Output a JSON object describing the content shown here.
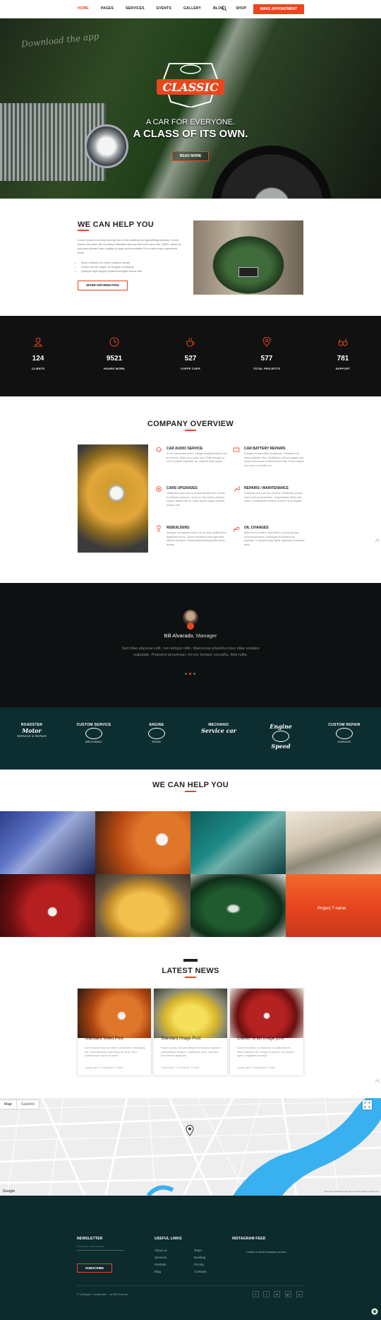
{
  "nav": {
    "items": [
      {
        "label": "HOME",
        "active": true
      },
      {
        "label": "PAGES",
        "active": false
      },
      {
        "label": "SERVICES",
        "active": false
      },
      {
        "label": "EVENTS",
        "active": false
      },
      {
        "label": "GALLERY",
        "active": false
      },
      {
        "label": "BLOG",
        "active": false
      },
      {
        "label": "SHOP",
        "active": false
      }
    ],
    "search_icon": "search-icon",
    "cta": "MAKE APPOINTMENT"
  },
  "hero": {
    "badge": "CLASSIC",
    "tagline1": "A CAR FOR EVERYONE.",
    "tagline2": "A CLASS OF ITS OWN.",
    "button": "READ MORE",
    "script_text": "Download the app"
  },
  "help": {
    "title": "WE CAN HELP YOU",
    "description": "Lorem ipsum is simply dummy text of the printing and typesetting industry. Lorem Ipsum has been the industry's standard dummy text ever since the 1500s, when an unknown printer took a galley of type and scrambled it to make a type specimen book.",
    "bullets": [
      "Nunc euismod eu tortor volutpat ornare",
      "Donec rutrum neque eu feugiat consequat",
      "Quisque eget augue pharetra fringilla cursus sed"
    ],
    "button": "MORE INFORMATION"
  },
  "stats": [
    {
      "icon": "user-icon",
      "value": "124",
      "label": "CLIENTS"
    },
    {
      "icon": "clock-icon",
      "value": "9521",
      "label": "HOURS WORK"
    },
    {
      "icon": "coffee-icon",
      "value": "527",
      "label": "COFFE CUPS"
    },
    {
      "icon": "location-icon",
      "value": "577",
      "label": "TOTAL PROJECTS"
    },
    {
      "icon": "glasses-icon",
      "value": "781",
      "label": "SUPPORT"
    }
  ],
  "overview": {
    "title": "COMPANY OVERVIEW",
    "services": [
      {
        "icon": "bell-icon",
        "title": "CAR AUDIO SERVICE",
        "desc": "In nec venenatis lorem. Integer volutpat lacinia orci et semper. Etiam ac a justo sed. Pellentesque eu orci id neque imperdiet vel, facilisis vitae augue."
      },
      {
        "icon": "battery-icon",
        "title": "CAR BATTERY REPAIRS",
        "desc": "Suscipit ex imperdiet vestibulum. Phasellus sit amet molestie nibh. Vestibulum dictum sapien sed neque accumsan condimentum erat. Fusce sapien non risus, convallis non."
      },
      {
        "icon": "gears-icon",
        "title": "CARS UPGRADES",
        "desc": "Vestibulum sed arcu in neque facilisis nec cursus et ultricies posuere. Lorem Curae Donec semper neque. Nullam vel et, lorem auctor augue laoreet lacinia velit."
      },
      {
        "icon": "wrench-icon",
        "title": "REPAIRS / MAINTENANCE",
        "desc": "Praesent nec erat iure pulvinar. Phasellus cursus nunc cursus elementum. Suspendisse tellus sed lorem, a sollicitudin tempus id tortor ut at magna."
      },
      {
        "icon": "trophy-icon",
        "title": "REBUILDERS",
        "desc": "Quisque consequat metus. At vel quis mollis lorem dignissim elit eu. Quam hendrerit nulla eget ante ultrices tincidunt. Morbi malesuada gravida lectus dictum."
      },
      {
        "icon": "oil-icon",
        "title": "OIL CHANGES",
        "desc": "Morbi id ac a tellus. Nam libero cursus ultrices. Sed sed posuere consequat et tincidunt mi molestie. In laoreet nulla ligula, dignissim a facilisis risus."
      }
    ]
  },
  "testimonial": {
    "name": "Bill Alvarado",
    "role": ", Manager",
    "quote": "Sed vitae placerat velit, non tempor nibh. Maecenas pharetra risus vitae sodales vulputate. Praesent accumsan, mi nec tempor convallis, felis nulla.",
    "dots": 3,
    "active_dot": 1
  },
  "brands": [
    {
      "top": "ROADSTER",
      "mid": "Motor",
      "bot": "SERVICE & REPAIR"
    },
    {
      "top": "CUSTOM SERVICE",
      "mid": "",
      "bot": "MECHANIC"
    },
    {
      "top": "ENGINE",
      "mid": "",
      "bot": "ROAD"
    },
    {
      "top": "MECHANIC",
      "mid": "Service car",
      "bot": ""
    },
    {
      "top": "Engine",
      "mid": "Speed",
      "bot": ""
    },
    {
      "top": "CUSTOM REPAIR",
      "mid": "",
      "bot": "GARAGE"
    }
  ],
  "gallery": {
    "title": "WE CAN HELP YOU",
    "hover_caption": "Project 7 name"
  },
  "news": {
    "title": "LATEST NEWS",
    "posts": [
      {
        "title": "Standard Video Post",
        "desc": "Lorem ipsum dolor sit amet, consectetur adipiscing elit. Nunc faucibus vitae libero sit amet. Sed pellentesque auctor et amet.",
        "meta": "4 years ago  /  0 comments  /  0 Likes"
      },
      {
        "title": "Standard Image Post",
        "desc": "Fusce cursus, est sed semper et rhoncus, ligula et pellentesque tempus. Vestibulum risus, vehicula, nec ultrices dignissim.",
        "meta": "4 years ago  /  0 comments  /  0 Likes"
      },
      {
        "title": "Classic small Image post",
        "desc": "Donec molestie, at maximus ex sollicitudin et. Nunc placerat nisi. Integer et dictum, sed dictum eget, a dignissim suscipit.",
        "meta": "4 years ago  /  0 comments  /  0 Likes"
      }
    ]
  },
  "map": {
    "tab_map": "Map",
    "tab_satellite": "Satellite",
    "credit": "Map data ©2020 Google   Terms of Use   Report a map error",
    "logo": "Google"
  },
  "footer": {
    "newsletter_title": "NEWSLETTER",
    "email_placeholder": "Enter your email address",
    "subscribe": "SUBSCRIBE",
    "links_title": "USEFUL LINKS",
    "links_col1": [
      "About us",
      "Services",
      "Portfolio",
      "Blog"
    ],
    "links_col2": [
      "Team",
      "Booking",
      "Pricing",
      "Contacts"
    ],
    "instagram_title": "INSTAGRAM FEED",
    "instagram_text": "Unable to show Instagram photos",
    "copyright": "© CarRepair | Created with ♡ by NRGThemes",
    "social": [
      "f",
      "t",
      "in",
      "g+",
      "p"
    ]
  }
}
